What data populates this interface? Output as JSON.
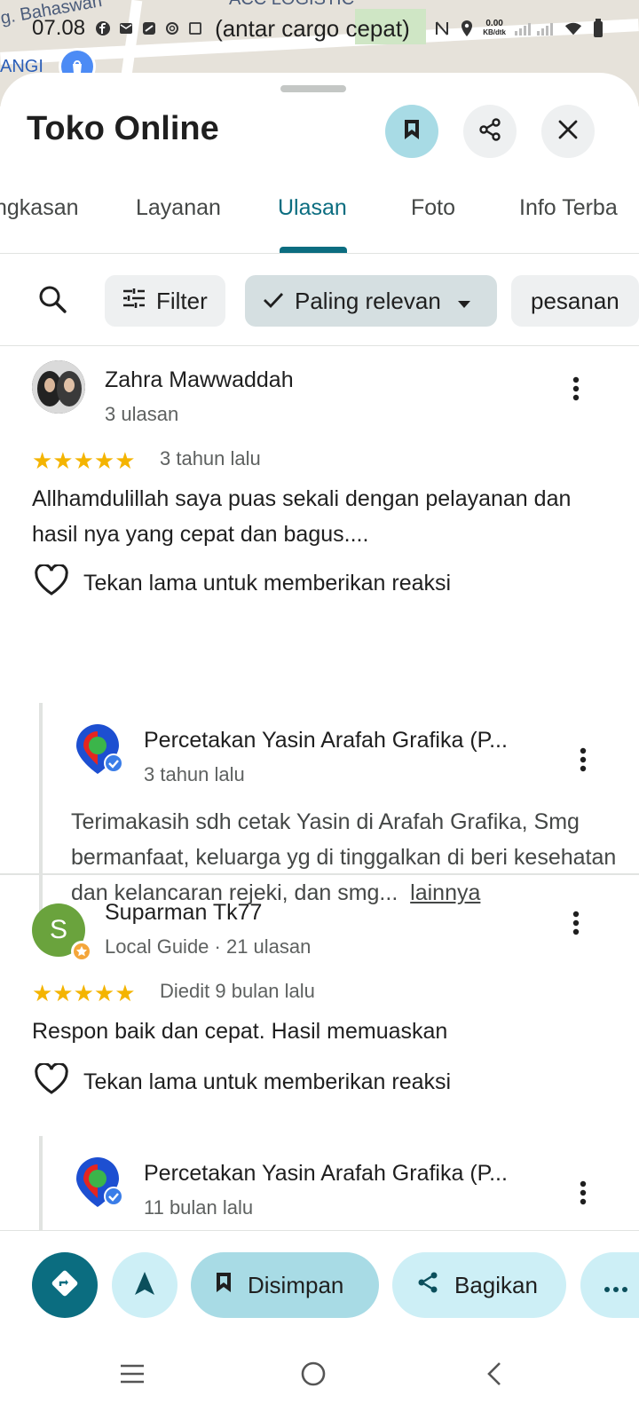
{
  "status_bar": {
    "time": "07.08",
    "net_speed_value": "0.00",
    "net_speed_unit": "KB/dtk",
    "icons": [
      "facebook-icon",
      "mail-icon",
      "app-icon",
      "openai-icon",
      "screenshot-icon",
      "nfc-icon",
      "location-icon",
      "signal-icon",
      "wifi-icon",
      "battery-icon"
    ]
  },
  "map": {
    "label_top_left": "g. Bahaswan",
    "label_top_center": "ACC LOGISTIC",
    "label_center": "(antar cargo cepat)",
    "label_left": "ANGI"
  },
  "place": {
    "title": "Toko Online"
  },
  "tabs": [
    {
      "label": "ngkasan"
    },
    {
      "label": "Layanan"
    },
    {
      "label": "Ulasan",
      "active": true
    },
    {
      "label": "Foto"
    },
    {
      "label": "Info Terba"
    }
  ],
  "filters": {
    "filter_label": "Filter",
    "sort_label": "Paling relevan",
    "topic_label": "pesanan"
  },
  "reviews": [
    {
      "name": "Zahra Mawwaddah",
      "meta": "3 ulasan",
      "rating": 5,
      "stars": "★★★★★",
      "date": "3 tahun lalu",
      "text": "Allhamdulillah saya puas sekali dengan pelayanan dan hasil nya yang cepat dan bagus....",
      "reaction_hint": "Tekan lama untuk memberikan reaksi",
      "owner_reply": {
        "name": "Percetakan Yasin Arafah Grafika (P...",
        "date": "3 tahun lalu",
        "text": "Terimakasih sdh cetak Yasin di Arafah Grafika, Smg bermanfaat, keluarga yg di tinggalkan di beri kesehatan dan kelancaran rejeki, dan smg...",
        "more_label": "lainnya"
      }
    },
    {
      "name": "Suparman Tk77",
      "avatar_letter": "S",
      "meta": "Local Guide · 21 ulasan",
      "rating": 5,
      "stars": "★★★★★",
      "date": "Diedit 9 bulan lalu",
      "text": "Respon baik dan cepat. Hasil memuaskan",
      "reaction_hint": "Tekan lama untuk memberikan reaksi",
      "owner_reply": {
        "name": "Percetakan Yasin Arafah Grafika (P...",
        "date": "11 bulan lalu"
      }
    }
  ],
  "actions": {
    "saved_label": "Disimpan",
    "share_label": "Bagikan"
  },
  "colors": {
    "accent": "#0b6d80",
    "saved_bg": "#a8dbe5",
    "star": "#f4b400"
  }
}
